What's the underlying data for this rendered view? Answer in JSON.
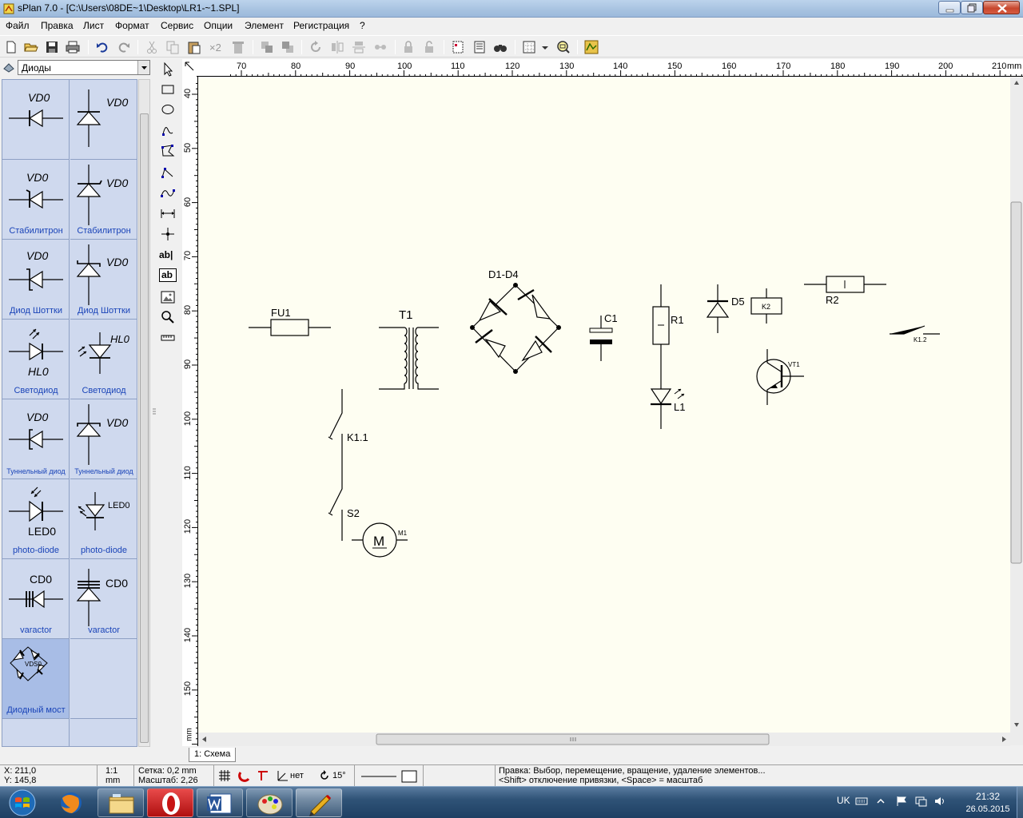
{
  "window": {
    "title": "sPlan 7.0 - [C:\\Users\\08DE~1\\Desktop\\LR1-~1.SPL]"
  },
  "menu": [
    "Файл",
    "Правка",
    "Лист",
    "Формат",
    "Сервис",
    "Опции",
    "Элемент",
    "Регистрация",
    "?"
  ],
  "toolbar": {
    "icons": [
      "new-file-icon",
      "open-folder-icon",
      "save-icon",
      "print-icon",
      "undo-icon",
      "redo-icon",
      "cut-icon",
      "copy-icon",
      "paste-icon",
      "duplicate-x2-icon",
      "delete-icon",
      "bring-front-icon",
      "send-back-icon",
      "rotate-icon",
      "mirror-h-icon",
      "mirror-v-icon",
      "group-icon",
      "lock-icon",
      "unlock-icon",
      "page-icon",
      "parts-list-icon",
      "find-icon",
      "grid-icon",
      "zoom-icon",
      "sheet-icon"
    ],
    "duplicate_label": "×2"
  },
  "library": {
    "selected": "Диоды",
    "items": [
      {
        "label": "VD0",
        "caption": ""
      },
      {
        "label": "VD0",
        "caption": ""
      },
      {
        "label": "VD0",
        "caption": "Стабилитрон"
      },
      {
        "label": "VD0",
        "caption": "Стабилитрон"
      },
      {
        "label": "VD0",
        "caption": "Диод Шоттки"
      },
      {
        "label": "VD0",
        "caption": "Диод Шоттки"
      },
      {
        "label": "HL0",
        "caption": "Светодиод"
      },
      {
        "label": "HL0",
        "caption": "Светодиод"
      },
      {
        "label": "VD0",
        "caption": "Туннельный диод"
      },
      {
        "label": "VD0",
        "caption": "Туннельный диод"
      },
      {
        "label": "LED0",
        "caption": "photo-diode"
      },
      {
        "label": "LED0",
        "caption": "photo-diode"
      },
      {
        "label": "CD0",
        "caption": "varactor"
      },
      {
        "label": "CD0",
        "caption": "varactor"
      },
      {
        "label": "VDS0",
        "caption": "Диодный мост"
      }
    ]
  },
  "drawing_tools": {
    "text_label": "ab|",
    "text_box_label": "ab"
  },
  "ruler": {
    "top_ticks": [
      "70",
      "80",
      "90",
      "100",
      "110",
      "120",
      "130",
      "140",
      "150",
      "160",
      "170",
      "180",
      "190",
      "200",
      "210"
    ],
    "unit": "mm",
    "left_ticks": [
      "40",
      "50",
      "60",
      "70",
      "80",
      "90",
      "100",
      "110",
      "120",
      "130",
      "140",
      "150"
    ]
  },
  "schematic": {
    "labels": {
      "fu1": "FU1",
      "t1": "T1",
      "d1d4": "D1-D4",
      "c1": "C1",
      "r1": "R1",
      "d5": "D5",
      "k2": "K2",
      "r2": "R2",
      "k12": "K1.2",
      "vt1": "VT1",
      "l1": "L1",
      "k11": "K1.1",
      "s2": "S2",
      "m1": "M1",
      "m": "M"
    }
  },
  "tabs": [
    "1: Схема"
  ],
  "status": {
    "x": "X: 211,0",
    "y": "Y: 145,8",
    "scale": "1:1",
    "unit": "mm",
    "grid": "Сетка: 0,2 mm",
    "zoom": "Масштаб:  2,26",
    "snap": "нет",
    "angle": "15°",
    "hint1": "Правка: Выбор, перемещение, вращение, удаление элементов...",
    "hint2": "<Shift> отключение привязки, <Space> = масштаб"
  },
  "taskbar": {
    "apps": [
      "firefox-icon",
      "explorer-folder-icon",
      "opera-icon",
      "word-icon",
      "paint-icon",
      "splan-icon"
    ],
    "lang": "UK",
    "time": "21:32",
    "date": "26.05.2015"
  },
  "colors": {
    "canvas": "#fefef2",
    "library_bg": "#cfd9ee",
    "library_caption": "#1a44b8",
    "taskbar": "#2f5377"
  }
}
